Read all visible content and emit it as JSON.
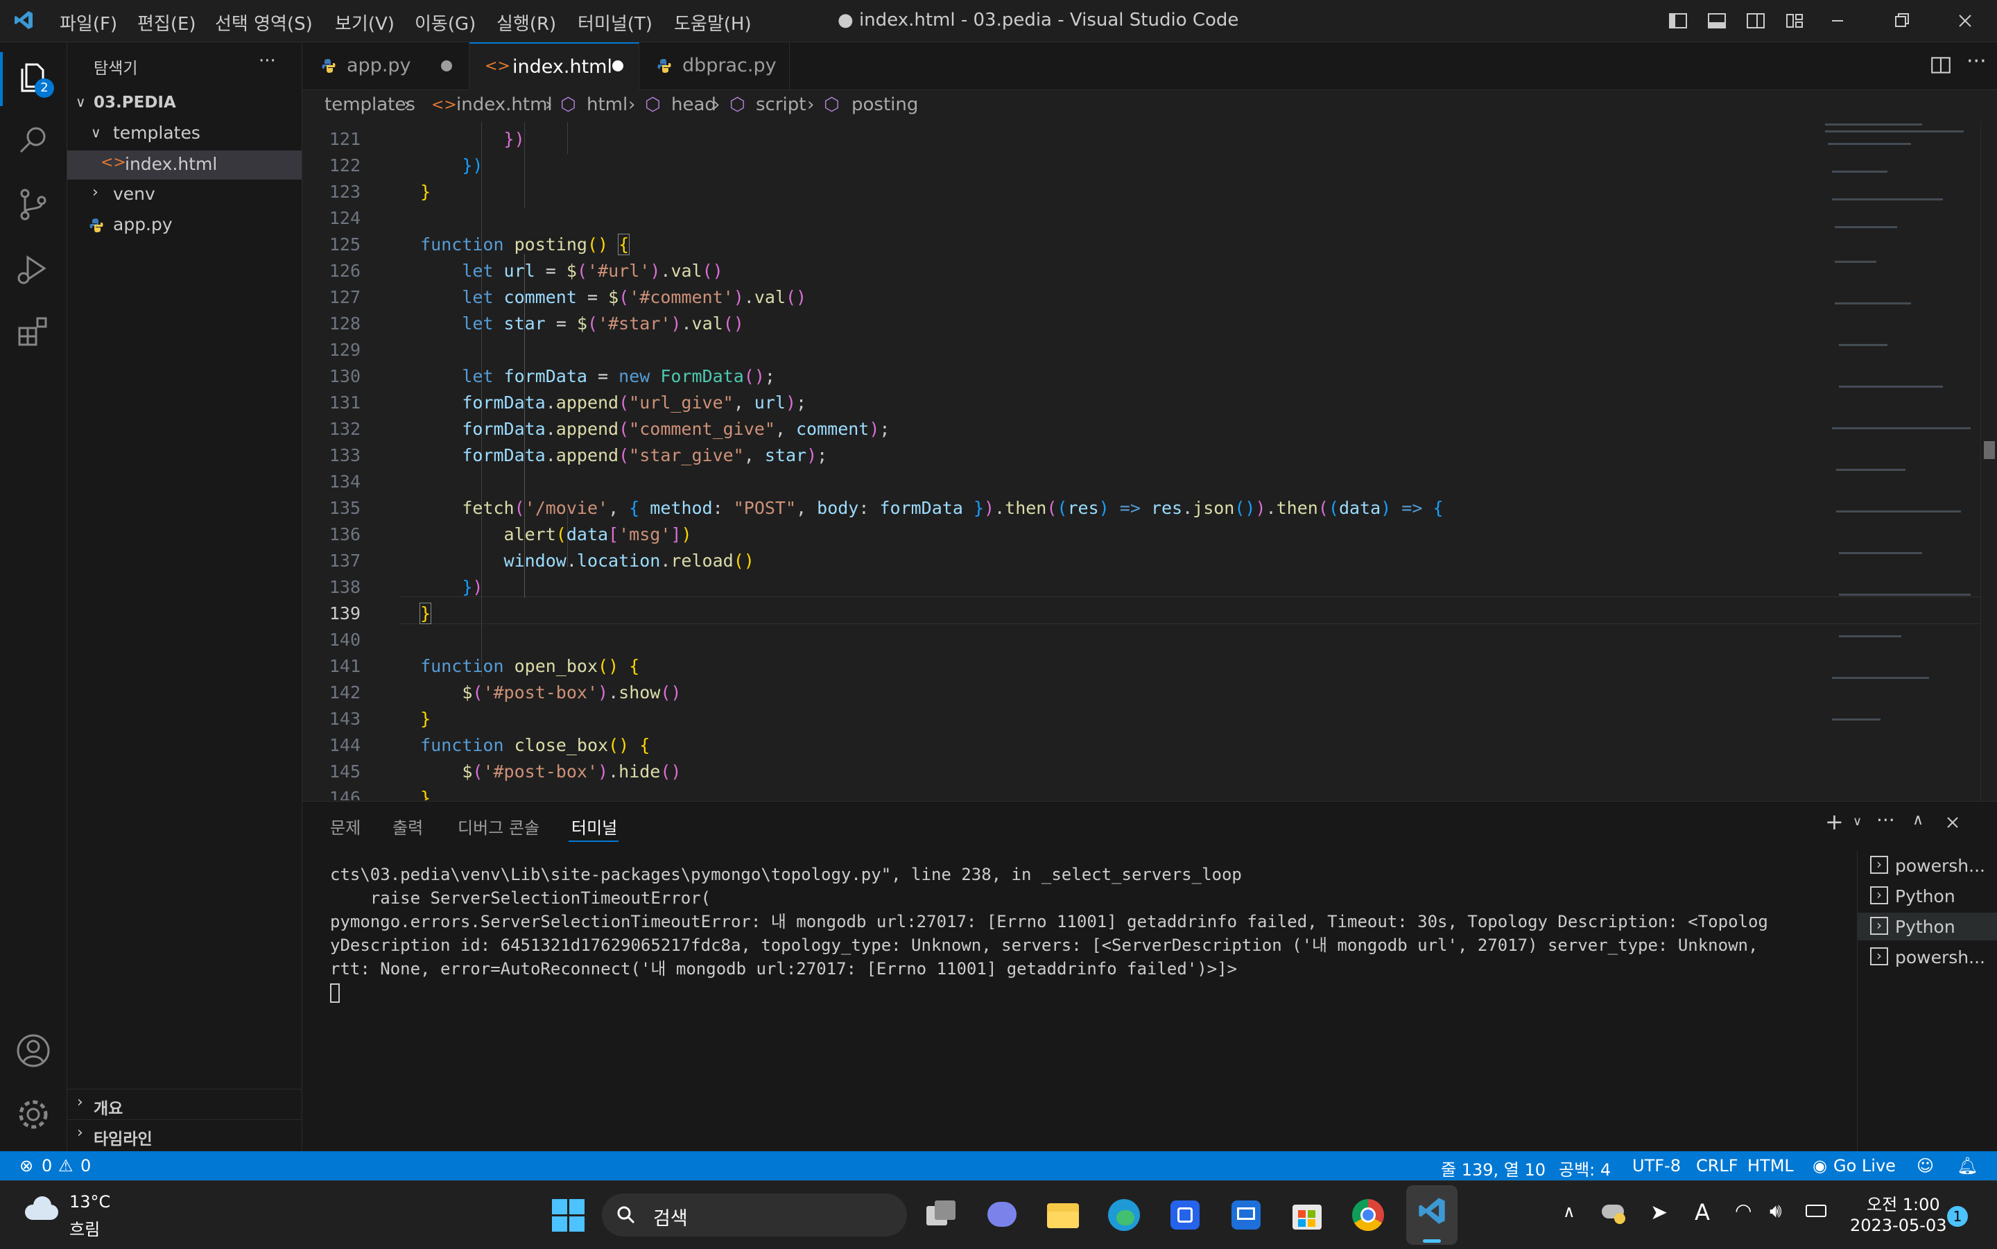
{
  "colors": {
    "accent": "#0078d4",
    "background": "#1e1e1e",
    "statusbar": "#0078d4",
    "keyword": "#569cd6",
    "function": "#dcdcaa",
    "string": "#ce9178",
    "variable": "#9cdcfe"
  },
  "titlebar": {
    "menu": [
      "파일(F)",
      "편집(E)",
      "선택 영역(S)",
      "보기(V)",
      "이동(G)",
      "실행(R)",
      "터미널(T)",
      "도움말(H)"
    ],
    "title": "● index.html - 03.pedia - Visual Studio Code",
    "icons": [
      "vscode-logo-icon",
      "layout-sidebar-left-icon",
      "layout-panel-icon",
      "layout-sidebar-right-icon",
      "customize-layout-icon",
      "minimize-icon",
      "restore-icon",
      "close-icon"
    ]
  },
  "activity": {
    "explorer_badge": "2",
    "icons": [
      "files-icon",
      "search-icon",
      "source-control-icon",
      "run-debug-icon",
      "extensions-icon",
      "account-icon",
      "settings-gear-icon"
    ]
  },
  "sidebar": {
    "title": "탐색기",
    "more": "···",
    "folder": "03.PEDIA",
    "items": [
      {
        "label": "templates",
        "type": "folder-open"
      },
      {
        "label": "index.html",
        "type": "html-file",
        "selected": true
      },
      {
        "label": "venv",
        "type": "folder"
      },
      {
        "label": "app.py",
        "type": "python-file"
      }
    ],
    "outline": "개요",
    "timeline": "타임라인"
  },
  "tabs": [
    {
      "label": "app.py",
      "modified": true,
      "active": false
    },
    {
      "label": "index.html",
      "modified": true,
      "active": true
    },
    {
      "label": "dbprac.py",
      "modified": false,
      "active": false
    }
  ],
  "breadcrumb": [
    "templates",
    "index.html",
    "html",
    "head",
    "script",
    "posting"
  ],
  "editor": {
    "current_line": "139",
    "line_numbers": [
      "121",
      "122",
      "123",
      "124",
      "125",
      "126",
      "127",
      "128",
      "129",
      "130",
      "131",
      "132",
      "133",
      "134",
      "135",
      "136",
      "137",
      "138",
      "139",
      "140",
      "141",
      "142",
      "143",
      "144",
      "145",
      "146"
    ],
    "code": {
      "l125_kw": "function",
      "l125_fn": "posting",
      "l126_kw": "let",
      "l126_var": "url",
      "l126_sel": "'#url'",
      "l126_fn": "val",
      "l127_var": "comment",
      "l127_sel": "'#comment'",
      "l128_var": "star",
      "l128_sel": "'#star'",
      "l130_var": "formData",
      "l130_new": "new",
      "l130_cls": "FormData",
      "l131_str": "\"url_give\"",
      "l132_str": "\"comment_give\"",
      "l133_str": "\"star_give\"",
      "append": "append",
      "l135_fetch": "fetch",
      "l135_str": "'/movie'",
      "l135_method": "method",
      "l135_post": "\"POST\"",
      "l135_body": "body",
      "then": "then",
      "res": "res",
      "json": "json",
      "data": "data",
      "l136_alert": "alert",
      "l136_msg": "'msg'",
      "l137_win": "window",
      "l137_loc": "location",
      "l137_reload": "reload",
      "l141_fn": "open_box",
      "l142_sel": "'#post-box'",
      "l142_show": "show",
      "l144_fn": "close_box",
      "l145_hide": "hide"
    }
  },
  "panel": {
    "tabs": [
      "문제",
      "출력",
      "디버그 콘솔",
      "터미널"
    ],
    "active_tab": "터미널",
    "terminal_lines": [
      "cts\\03.pedia\\venv\\Lib\\site-packages\\pymongo\\topology.py\", line 238, in _select_servers_loop",
      "    raise ServerSelectionTimeoutError(",
      "pymongo.errors.ServerSelectionTimeoutError: 내 mongodb url:27017: [Errno 11001] getaddrinfo failed, Timeout: 30s, Topology Description: <Topolog",
      "yDescription id: 6451321d17629065217fdc8a, topology_type: Unknown, servers: [<ServerDescription ('내 mongodb url', 27017) server_type: Unknown,",
      "rtt: None, error=AutoReconnect('내 mongodb url:27017: [Errno 11001] getaddrinfo failed')>]>"
    ],
    "terminals": [
      "powersh...",
      "Python",
      "Python",
      "powersh..."
    ],
    "active_terminal": 2
  },
  "statusbar": {
    "errors": "0",
    "warnings": "0",
    "position": "줄 139, 열 10",
    "spaces": "공백: 4",
    "encoding": "UTF-8",
    "eol": "CRLF",
    "language": "HTML",
    "golive": "Go Live"
  },
  "taskbar": {
    "weather_temp": "13°C",
    "weather_desc": "흐림",
    "search": "검색",
    "time": "오전 1:00",
    "date": "2023-05-03",
    "notif": "1"
  }
}
